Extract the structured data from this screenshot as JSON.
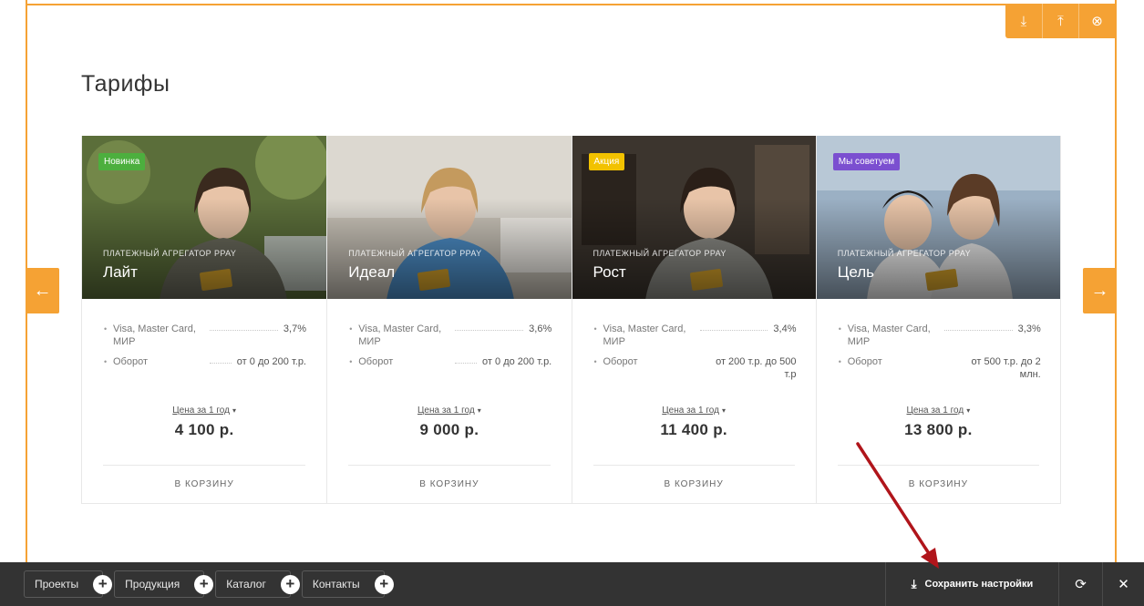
{
  "section": {
    "title": "Тарифы"
  },
  "frame_toolbar": {
    "icons": [
      "move-down-icon",
      "move-up-icon",
      "close-circle-icon"
    ],
    "glyphs": [
      "⤓",
      "⤒",
      "⊗"
    ]
  },
  "slider": {
    "prev_glyph": "←",
    "next_glyph": "→",
    "prev_small": "‹",
    "next_small": "›"
  },
  "cards": [
    {
      "badge": "Новинка",
      "badge_color": "#4caf3e",
      "subtitle": "ПЛАТЕЖНЫЙ АГРЕГАТОР PPAY",
      "name": "Лайт",
      "props": [
        {
          "name": "Visa, Master Card, МИР",
          "value": "3,7%"
        },
        {
          "name": "Оборот",
          "value": "от 0 до 200 т.р."
        }
      ],
      "price_label": "Цена за 1 год",
      "price": "4 100 р.",
      "cart": "В КОРЗИНУ",
      "photo_bg": "#5b6e3a"
    },
    {
      "badge": "",
      "badge_color": "",
      "subtitle": "ПЛАТЕЖНЫЙ АГРЕГАТОР PPAY",
      "name": "Идеал",
      "props": [
        {
          "name": "Visa, Master Card, МИР",
          "value": "3,6%"
        },
        {
          "name": "Оборот",
          "value": "от 0 до 200 т.р."
        }
      ],
      "price_label": "Цена за 1 год",
      "price": "9 000 р.",
      "cart": "В КОРЗИНУ",
      "photo_bg": "#c9c3b8"
    },
    {
      "badge": "Акция",
      "badge_color": "#f2c200",
      "subtitle": "ПЛАТЕЖНЫЙ АГРЕГАТОР PPAY",
      "name": "Рост",
      "props": [
        {
          "name": "Visa, Master Card, МИР",
          "value": "3,4%"
        },
        {
          "name": "Оборот",
          "value": "от 200 т.р. до 500 т.р"
        }
      ],
      "price_label": "Цена за 1 год",
      "price": "11 400 р.",
      "cart": "В КОРЗИНУ",
      "photo_bg": "#3c352e"
    },
    {
      "badge": "Мы советуем",
      "badge_color": "#7b4fd0",
      "subtitle": "ПЛАТЕЖНЫЙ АГРЕГАТОР PPAY",
      "name": "Цель",
      "props": [
        {
          "name": "Visa, Master Card, МИР",
          "value": "3,3%"
        },
        {
          "name": "Оборот",
          "value": "от 500 т.р. до 2 млн."
        }
      ],
      "price_label": "Цена за 1 год",
      "price": "13 800 р.",
      "cart": "В КОРЗИНУ",
      "photo_bg": "#9bb0c4"
    }
  ],
  "admin_bar": {
    "menu": [
      {
        "label": "Проекты"
      },
      {
        "label": "Продукция"
      },
      {
        "label": "Каталог"
      },
      {
        "label": "Контакты"
      }
    ],
    "plus_glyph": "+",
    "save_label": "Сохранить настройки",
    "save_glyph": "⤓",
    "refresh_glyph": "⟳",
    "close_glyph": "✕"
  },
  "colors": {
    "accent": "#f5a234",
    "admin_bg": "#333333",
    "annotation": "#b0151b"
  }
}
